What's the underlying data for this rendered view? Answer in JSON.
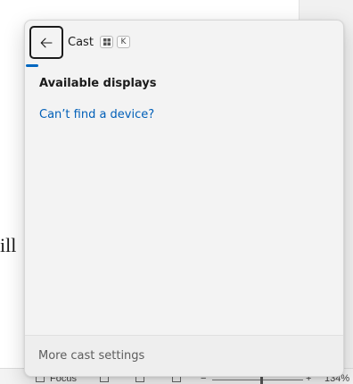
{
  "background_document": {
    "visible_text": "ill",
    "status_bar": {
      "focus_label": "Focus",
      "zoom_minus": "−",
      "zoom_plus": "+",
      "zoom_level": "134%"
    }
  },
  "cast_panel": {
    "title": "Cast",
    "shortcut_keys": [
      "⊞",
      "K"
    ],
    "back_icon": "arrow-left-icon",
    "section_heading": "Available displays",
    "help_link": "Can’t find a device?",
    "footer_link": "More cast settings",
    "accent_color": "#0067c0",
    "link_color": "#005fb8",
    "scanning": true
  }
}
